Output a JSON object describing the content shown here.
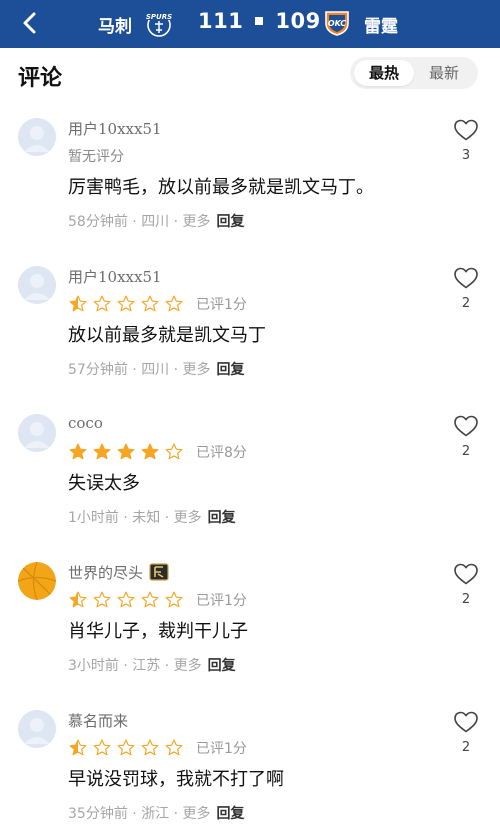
{
  "header": {
    "home_team": "马刺",
    "home_score": "111",
    "away_score": "109",
    "away_team": "雷霆",
    "home_logo_text": "SPURS",
    "away_logo_text": "OKC",
    "bg_color": "#1d4f98"
  },
  "section": {
    "title": "评论",
    "sort_tabs": [
      "最热",
      "最新"
    ],
    "active_tab": "最热"
  },
  "comments": [
    {
      "user": "用户10xxx51",
      "rating_label": "暂无评分",
      "rating_value": null,
      "rating_text": "",
      "content": "厉害鸭毛，放以前最多就是凯文马丁。",
      "time": "58分钟前",
      "location": "四川",
      "more": "更多",
      "reply": "回复",
      "likes": "3"
    },
    {
      "user": "用户10xxx51",
      "rating_label": "",
      "rating_value": 0.5,
      "rating_text": "已评1分",
      "content": "放以前最多就是凯文马丁",
      "time": "57分钟前",
      "location": "四川",
      "more": "更多",
      "reply": "回复",
      "likes": "2"
    },
    {
      "user": "coco",
      "rating_label": "",
      "rating_value": 4,
      "rating_text": "已评8分",
      "content": "失误太多",
      "time": "1小时前",
      "location": "未知",
      "more": "更多",
      "reply": "回复",
      "likes": "2"
    },
    {
      "user": "世界的尽头",
      "rating_label": "",
      "rating_value": 0.5,
      "rating_text": "已评1分",
      "content": "肖华儿子，裁判干儿子",
      "time": "3小时前",
      "location": "江苏",
      "more": "更多",
      "reply": "回复",
      "likes": "2"
    },
    {
      "user": "慕名而来",
      "rating_label": "",
      "rating_value": 0.5,
      "rating_text": "已评1分",
      "content": "早说没罚球，我就不打了啊",
      "time": "35分钟前",
      "location": "浙江",
      "more": "更多",
      "reply": "回复",
      "likes": "2"
    }
  ],
  "colors": {
    "star": "#f5a623",
    "star_empty_stroke": "#f5a623",
    "meta_text": "#a6a6a6"
  }
}
